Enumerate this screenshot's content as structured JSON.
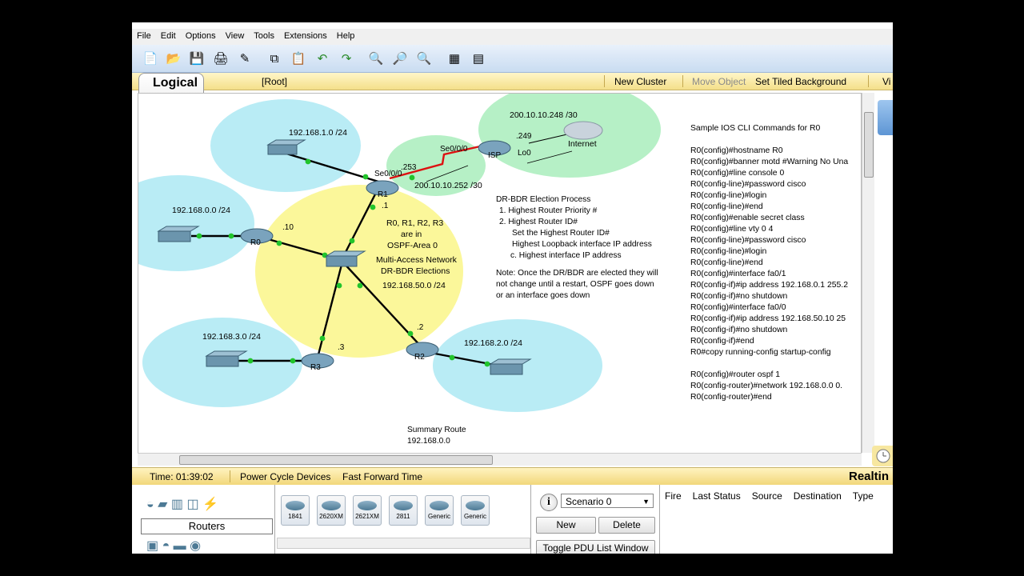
{
  "menu": [
    "File",
    "Edit",
    "Options",
    "View",
    "Tools",
    "Extensions",
    "Help"
  ],
  "workspace": {
    "tab": "Logical",
    "root": "[Root]",
    "new_cluster": "New Cluster",
    "move_object": "Move Object",
    "tiled_bg": "Set Tiled Background",
    "viewport": "Vi"
  },
  "network": {
    "subnets": {
      "s1": "192.168.1.0 /24",
      "s0": "192.168.0.0 /24",
      "s3": "192.168.3.0 /24",
      "s2": "192.168.2.0 /24",
      "s50": "192.168.50.0 /24",
      "isp_link": "200.10.10.252 /30",
      "inet": "200.10.10.248 /30"
    },
    "devices": {
      "r0": "R0",
      "r1": "R1",
      "r2": "R2",
      "r3": "R3",
      "isp": "ISP",
      "internet": "Internet"
    },
    "ip_labels": {
      "se_r1": "Se0/0/0",
      "se_isp": "Se0/0/0",
      "r1_253": ".253",
      "r1_1": ".1",
      "r0_10": ".10",
      "r3_3": ".3",
      "r2_2": ".2",
      "isp_249": ".249",
      "lo0": "Lo0"
    },
    "notes": {
      "area1": "R0, R1, R2, R3",
      "area2": "are in",
      "area3": "OSPF-Area 0",
      "multi1": "Multi-Access Network",
      "multi2": "DR-BDR Elections",
      "summary1": "Summary Route",
      "summary2": "192.168.0.0"
    }
  },
  "election": {
    "title": "DR-BDR Election Process",
    "l1": "1. Highest Router Priority #",
    "l2": "2. Highest Router ID#",
    "l3": "Set the Highest Router ID#",
    "l4": "Highest Loopback interface IP address",
    "l5": "c. Highest interface IP address",
    "note1": "Note: Once the DR/BDR are elected they will",
    "note2": "not change until a restart, OSPF goes down",
    "note3": "or an interface goes down"
  },
  "cli": {
    "title": "Sample IOS CLI Commands for R0",
    "lines": [
      "R0(config)#hostname R0",
      "R0(config)#banner motd #Warning No Una",
      "R0(config)#line console 0",
      "R0(config-line)#password cisco",
      "R0(config-line)#login",
      "R0(config-line)#end",
      "R0(config)#enable secret class",
      "R0(config)#line vty 0 4",
      "R0(config-line)#password cisco",
      "R0(config-line)#login",
      "R0(config-line)#end",
      "R0(config)#interface fa0/1",
      "R0(config-if)#ip address 192.168.0.1 255.2",
      "R0(config-if)#no shutdown",
      "R0(config)#interface fa0/0",
      "R0(config-if)#ip address 192.168.50.10 25",
      "R0(config-if)#no shutdown",
      "R0(config-if)#end",
      "R0#copy running-config startup-config",
      "",
      "R0(config)#router ospf 1",
      "R0(config-router)#network 192.168.0.0 0.",
      "R0(config-router)#end"
    ]
  },
  "status": {
    "time": "Time: 01:39:02",
    "power": "Power Cycle Devices",
    "fast": "Fast Forward Time",
    "realtime": "Realtin"
  },
  "devices_panel": {
    "category": "Routers",
    "models": [
      "1841",
      "2620XM",
      "2621XM",
      "2811",
      "Generic",
      "Generic"
    ]
  },
  "pdu": {
    "scenario": "Scenario 0",
    "new": "New",
    "delete": "Delete",
    "toggle": "Toggle PDU List Window",
    "cols": [
      "Fire",
      "Last Status",
      "Source",
      "Destination",
      "Type"
    ]
  }
}
